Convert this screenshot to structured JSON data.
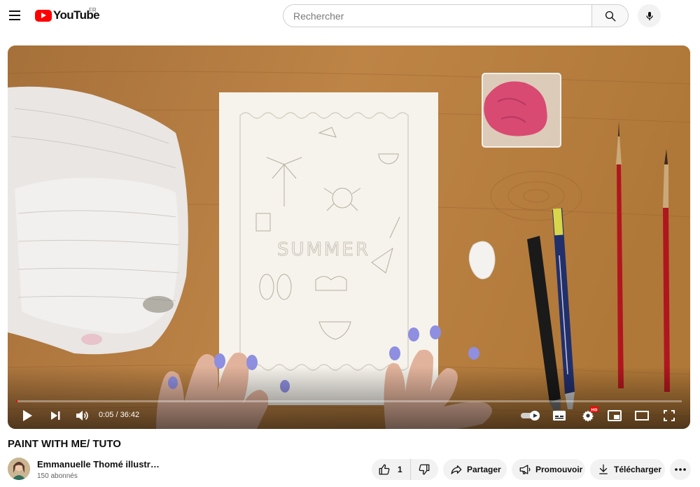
{
  "header": {
    "logo_text": "YouTube",
    "country_code": "FR",
    "search_placeholder": "Rechercher"
  },
  "player": {
    "progress_fraction": 0.0023,
    "time_display": "0:05 / 36:42",
    "scene": {
      "paper_text": "SUMMER"
    }
  },
  "video": {
    "title": "PAINT WITH ME/ TUTO",
    "channel_name": "Emmanuelle Thomé illustr…",
    "subscribers": "150 abonnés"
  },
  "actions": {
    "like_count": "1",
    "share_label": "Partager",
    "promote_label": "Promouvoir",
    "download_label": "Télécharger"
  },
  "icons": [
    "menu-icon",
    "youtube-logo-icon",
    "search-icon",
    "mic-icon",
    "play-icon",
    "next-icon",
    "volume-icon",
    "autoplay-toggle-icon",
    "subtitles-icon",
    "settings-icon",
    "hd-badge-icon",
    "miniplayer-icon",
    "theater-icon",
    "fullscreen-icon",
    "thumbs-up-icon",
    "thumbs-down-icon",
    "share-icon",
    "megaphone-icon",
    "download-icon",
    "more-icon"
  ],
  "colors": {
    "brand_red": "#ff0000",
    "table_wood": "#b07a3c",
    "nail_polish": "#8e8fe0"
  }
}
